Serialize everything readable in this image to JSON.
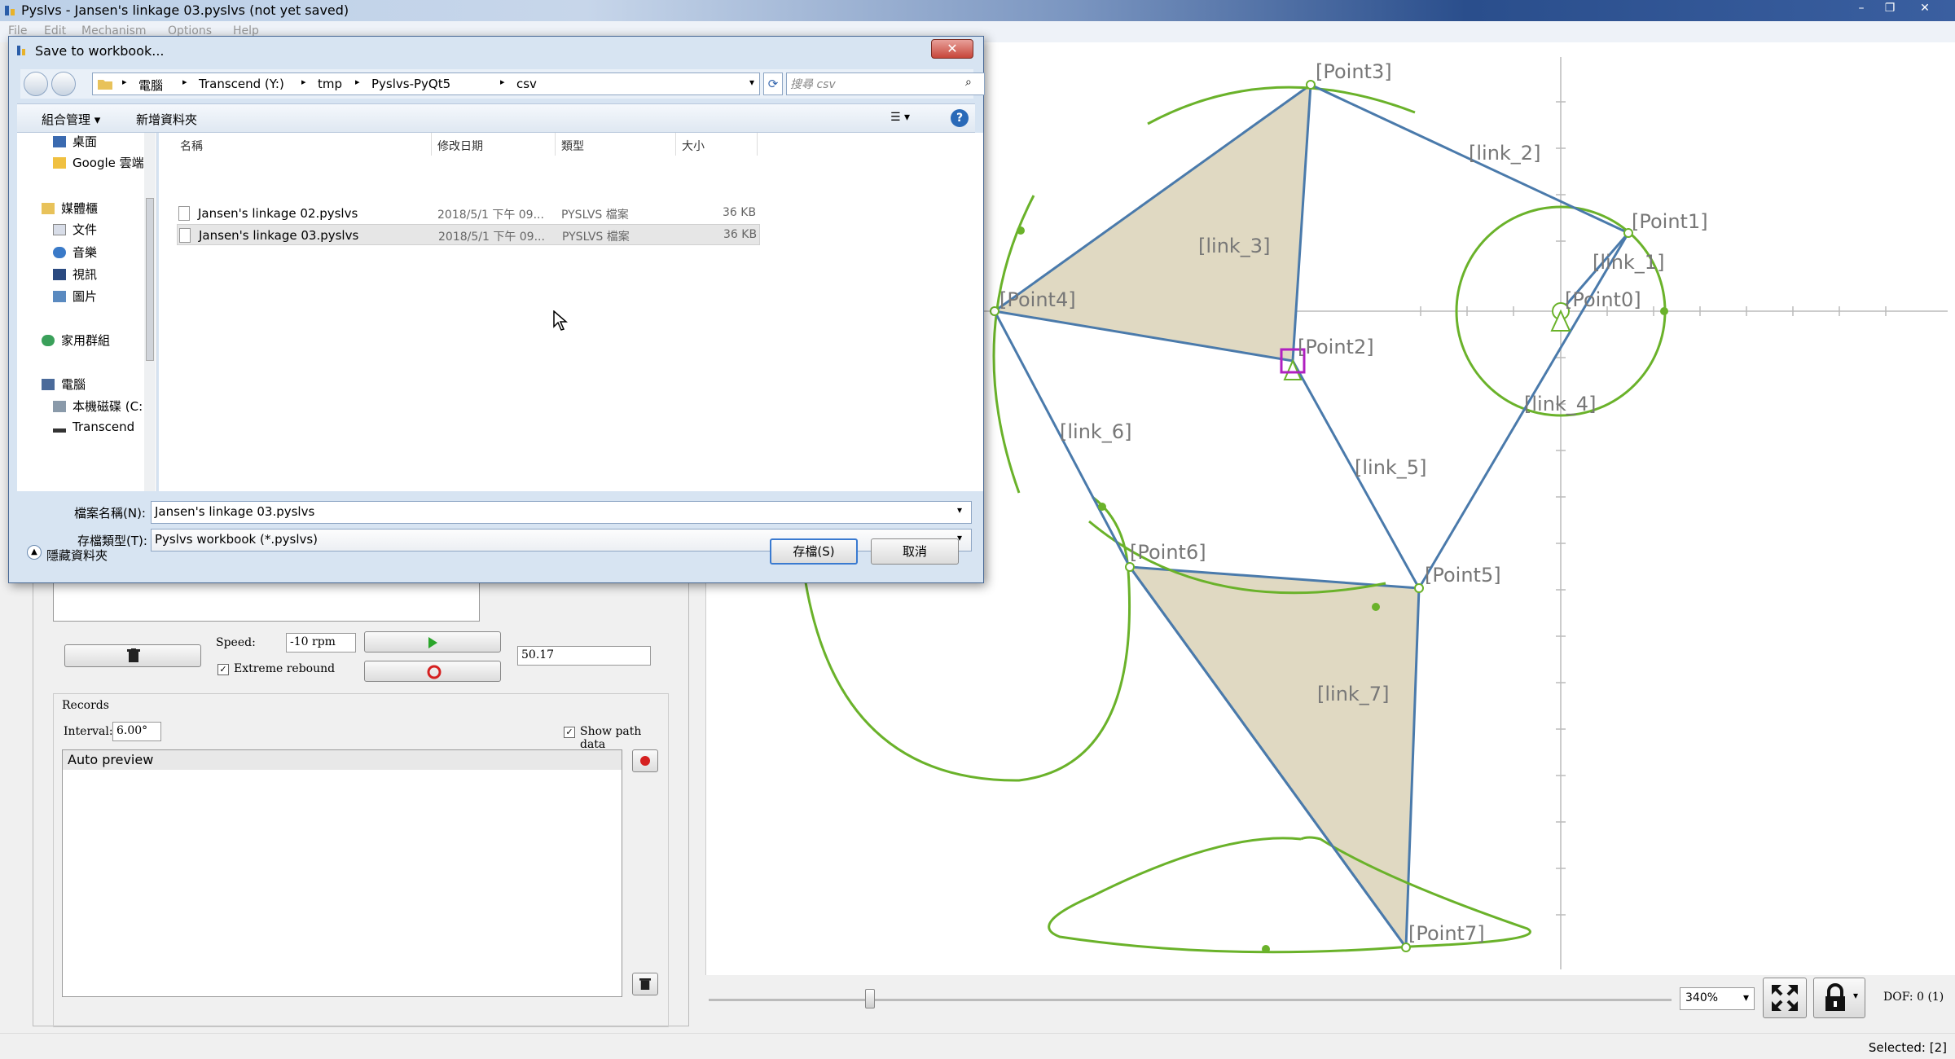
{
  "app": {
    "title": "Pyslvs - Jansen's linkage 03.pyslvs (not yet saved)",
    "menu": [
      "File",
      "Edit",
      "Mechanism",
      "Options",
      "Help"
    ]
  },
  "dialog": {
    "title": "Save to workbook...",
    "breadcrumbs": [
      "電腦",
      "Transcend (Y:)",
      "tmp",
      "Pyslvs-PyQt5",
      "csv"
    ],
    "search_placeholder": "搜尋 csv",
    "toolbar": {
      "organize": "組合管理 ▾",
      "new_folder": "新增資料夾"
    },
    "nav": {
      "desktop": "桌面",
      "google": "Google 雲端",
      "libraries": "媒體櫃",
      "docs": "文件",
      "music": "音樂",
      "video": "視訊",
      "pictures": "圖片",
      "homegroup": "家用群組",
      "computer": "電腦",
      "local_disk": "本機磁碟 (C:",
      "transcend": "Transcend"
    },
    "columns": {
      "name": "名稱",
      "date": "修改日期",
      "type": "類型",
      "size": "大小"
    },
    "files": [
      {
        "name": "Jansen's linkage 02.pyslvs",
        "date": "2018/5/1 下午 09...",
        "type": "PYSLVS 檔案",
        "size": "36 KB"
      },
      {
        "name": "Jansen's linkage 03.pyslvs",
        "date": "2018/5/1 下午 09...",
        "type": "PYSLVS 檔案",
        "size": "36 KB"
      }
    ],
    "filename_label": "檔案名稱(N):",
    "filename_value": "Jansen's linkage 03.pyslvs",
    "filetype_label": "存檔類型(T):",
    "filetype_value": "Pyslvs workbook (*.pyslvs)",
    "hide_folders": "隱藏資料夾",
    "save_button": "存檔(S)",
    "cancel_button": "取消"
  },
  "panel": {
    "speed_label": "Speed:",
    "speed_value": "-10 rpm",
    "extreme_rebound": "Extreme rebound",
    "angle_value": "50.17",
    "records_title": "Records",
    "interval_label": "Interval:",
    "interval_value": "6.00°",
    "show_path_data": "Show path data",
    "record_item": "Auto preview"
  },
  "canvas": {
    "labels": {
      "p0": "[Point0]",
      "p1": "[Point1]",
      "p2": "[Point2]",
      "p3": "[Point3]",
      "p4": "[Point4]",
      "p5": "[Point5]",
      "p6": "[Point6]",
      "p7": "[Point7]",
      "l1": "[link_1]",
      "l2": "[link_2]",
      "l3": "[link_3]",
      "l4": "[link_4]",
      "l5": "[link_5]",
      "l6": "[link_6]",
      "l7": "[link_7]"
    },
    "link_color": "#4a7aab",
    "path_color": "#6ab22a",
    "fill_color": "#e0d9c2"
  },
  "status": {
    "zoom": "340%",
    "dof": "DOF: 0 (1)",
    "selected": "Selected: [2]"
  }
}
